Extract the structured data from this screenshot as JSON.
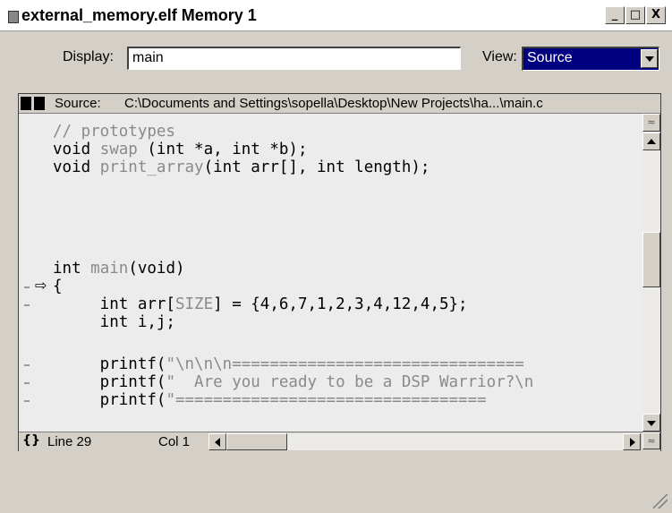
{
  "window": {
    "title": "external_memory.elf Memory 1",
    "buttons": {
      "minimize": "_",
      "maximize": "□",
      "close": "X"
    }
  },
  "toolbar": {
    "display_label": "Display:",
    "display_value": "main",
    "view_label": "View:",
    "view_value": "Source"
  },
  "source": {
    "label": "Source:",
    "path": "C:\\Documents and Settings\\sopella\\Desktop\\New Projects\\ha...\\main.c"
  },
  "code": {
    "l1": "// prototypes",
    "l2a": "void ",
    "l2b": "swap",
    "l2c": " (int *a, int *b);",
    "l3a": "void ",
    "l3b": "print_array",
    "l3c": "(int arr[], int length);",
    "l4a": "int ",
    "l4b": "main",
    "l4c": "(void)",
    "l5": "{",
    "l6a": "     int arr[",
    "l6b": "SIZE",
    "l6c": "] = {4,6,7,1,2,3,4,12,4,5};",
    "l7": "     int i,j;",
    "l8a": "     printf(",
    "l8b": "\"\\n\\n\\n===============================",
    "l9a": "     printf(",
    "l9b": "\"  Are you ready to be a DSP Warrior?\\n",
    "l10a": "     printf(",
    "l10b": "\"================================="
  },
  "status": {
    "icon": "{}",
    "line": "Line 29",
    "col": "Col 1"
  }
}
